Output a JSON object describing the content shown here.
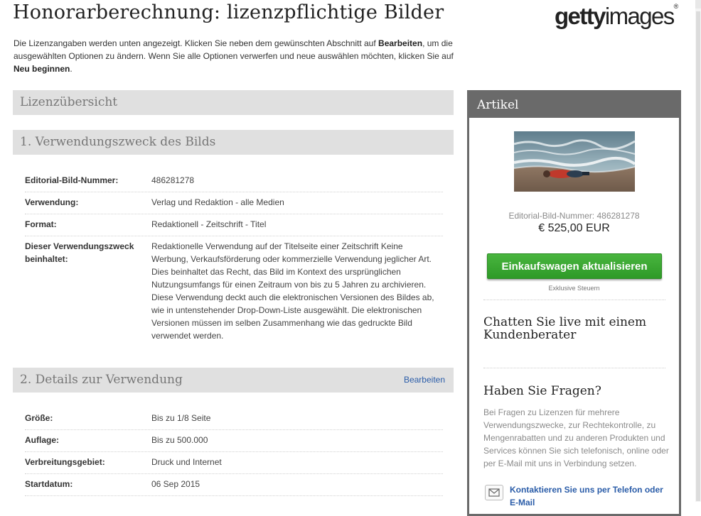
{
  "header": {
    "title": "Honorarberechnung: lizenzpflichtige Bilder",
    "logo_main": "getty",
    "logo_sub": "images",
    "logo_mark": "®",
    "intro_1": "Die Lizenzangaben werden unten angezeigt. Klicken Sie neben dem gewünschten Abschnitt auf ",
    "intro_b1": "Bearbeiten",
    "intro_2": ", um die ausgewählten Optionen zu ändern. Wenn Sie alle Optionen verwerfen und neue auswählen möchten, klicken Sie auf ",
    "intro_b2": "Neu beginnen",
    "intro_3": "."
  },
  "overview": {
    "title": "Lizenzübersicht"
  },
  "section1": {
    "title": "1. Verwendungszweck des Bilds",
    "rows": [
      {
        "key": "Editorial-Bild-Nummer:",
        "value": "486281278"
      },
      {
        "key": "Verwendung:",
        "value": "Verlag und Redaktion - alle Medien"
      },
      {
        "key": "Format:",
        "value": "Redaktionell - Zeitschrift - Titel"
      },
      {
        "key": "Dieser Verwendungszweck beinhaltet:",
        "value": "Redaktionelle Verwendung auf der Titelseite einer Zeitschrift Keine Werbung, Verkaufsförderung oder kommerzielle Verwendung jeglicher Art. Dies beinhaltet das Recht, das Bild im Kontext des ursprünglichen Nutzungsumfangs für einen Zeitraum von bis zu 5 Jahren zu archivieren. Diese Verwendung deckt auch die elektronischen Versionen des Bildes ab, wie in untenstehender Drop-Down-Liste ausgewählt. Die elektronischen Versionen müssen im selben Zusammenhang wie das gedruckte Bild verwendet werden."
      }
    ]
  },
  "section2": {
    "title": "2. Details zur Verwendung",
    "edit_label": "Bearbeiten",
    "rows": [
      {
        "key": "Größe:",
        "value": "Bis zu 1/8 Seite"
      },
      {
        "key": "Auflage:",
        "value": "Bis zu 500.000"
      },
      {
        "key": "Verbreitungsgebiet:",
        "value": "Druck und Internet"
      },
      {
        "key": "Startdatum:",
        "value": "06 Sep 2015"
      }
    ]
  },
  "panel": {
    "title": "Artikel",
    "image_number": "Editorial-Bild-Nummer: 486281278",
    "price": "€ 525,00 EUR",
    "cart_button": "Einkaufswagen aktualisieren",
    "tax_note": "Exklusive Steuern",
    "chat_title": "Chatten Sie live mit einem Kundenberater",
    "faq_title": "Haben Sie Fragen?",
    "faq_text": "Bei Fragen zu Lizenzen für mehrere Verwendungszwecke, zur Rechtekontrolle, zu Mengenrabatten und zu anderen Produkten und Services können Sie sich telefonisch, online oder per E-Mail mit uns in Verbindung setzen.",
    "contact_link": "Kontaktieren Sie uns per Telefon oder E-Mail",
    "contact_icon": "envelope-icon"
  }
}
